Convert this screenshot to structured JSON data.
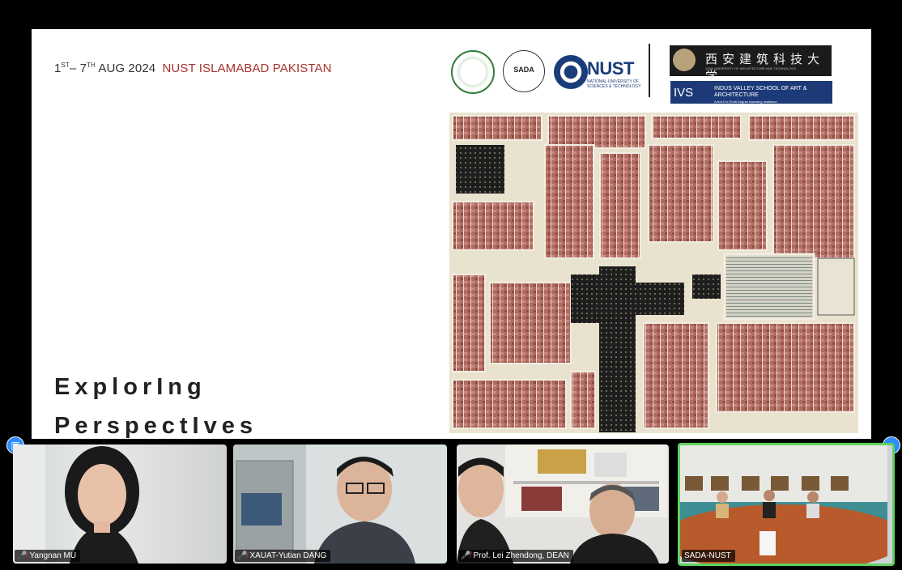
{
  "slide": {
    "header_date": "1ST– 7TH AUG 2024",
    "header_date_parts": {
      "d1": "1",
      "s1": "ST",
      "mid": "– 7",
      "s2": "TH",
      "rest": " AUG 2024"
    },
    "header_venue": "NUST ISLAMABAD PAKISTAN",
    "title_line1": "ExplorIng",
    "title_line2": "PerspectIves",
    "logos": {
      "sada": "SADA",
      "nust": "NUST",
      "nust_sub": "NATIONAL UNIVERSITY OF SCIENCES & TECHNOLOGY",
      "xauat_cn": "西安建筑科技大学",
      "xauat_en": "XI'AN UNIVERSITY OF ARCHITECTURE AND TECHNOLOGY",
      "ivs_mark": "IVS",
      "ivs_text": "INDUS VALLEY SCHOOL OF ART & ARCHITECTURE",
      "ivs_sub": "A Not-For-Profit Degree Awarding Institution"
    }
  },
  "participants": [
    {
      "name": "Yangnan MU",
      "muted": true
    },
    {
      "name": "XAUAT-Yutian DANG",
      "muted": true
    },
    {
      "name": "Prof. Lei Zhendong, DEAN",
      "muted": true
    },
    {
      "name": "SADA-NUST",
      "muted": false,
      "active_speaker": true
    }
  ],
  "controls": {
    "gallery_left_icon": "photo-icon",
    "gallery_right_icon": "minus-icon"
  },
  "colors": {
    "venue": "#a5332b",
    "zoom_blue": "#2d8cff",
    "active_border": "#5fd35f",
    "muted_mic": "#e53935"
  }
}
